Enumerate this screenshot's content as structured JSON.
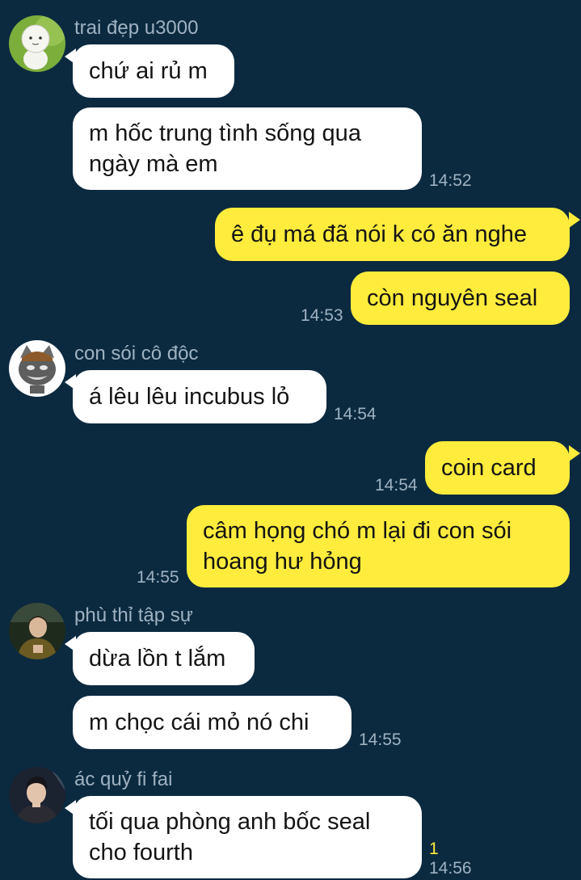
{
  "colors": {
    "background": "#0b2a40",
    "incoming_bubble": "#ffffff",
    "outgoing_bubble": "#ffec3d",
    "meta_text": "#9fb2c1",
    "unread_count": "#ffec3d"
  },
  "senders": {
    "s1": "trai đẹp u3000",
    "s2": "con sói cô độc",
    "s3": "phù thỉ tập sự",
    "s4": "ác quỷ fi fai"
  },
  "messages": {
    "m1": {
      "lines": [
        "chứ ai rủ m"
      ]
    },
    "m2": {
      "lines": [
        "m hốc trung tình sống qua",
        "ngày mà em"
      ],
      "time": "14:52"
    },
    "m3": {
      "lines": [
        "ê đụ má đã nói k có ăn nghe"
      ]
    },
    "m4": {
      "lines": [
        "còn nguyên seal"
      ],
      "time": "14:53"
    },
    "m5": {
      "lines": [
        "á lêu lêu incubus lỏ"
      ],
      "time": "14:54"
    },
    "m6": {
      "lines": [
        "coin card"
      ],
      "time": "14:54"
    },
    "m7": {
      "lines": [
        "câm họng chó m lại đi con sói",
        "hoang hư hỏng"
      ],
      "time": "14:55"
    },
    "m8": {
      "lines": [
        "dừa lồn t lắm"
      ]
    },
    "m9": {
      "lines": [
        "m chọc cái mỏ nó chi"
      ],
      "time": "14:55"
    },
    "m10": {
      "lines": [
        "tối qua phòng anh bốc seal",
        "cho fourth"
      ],
      "time": "14:56",
      "unread": "1"
    }
  }
}
